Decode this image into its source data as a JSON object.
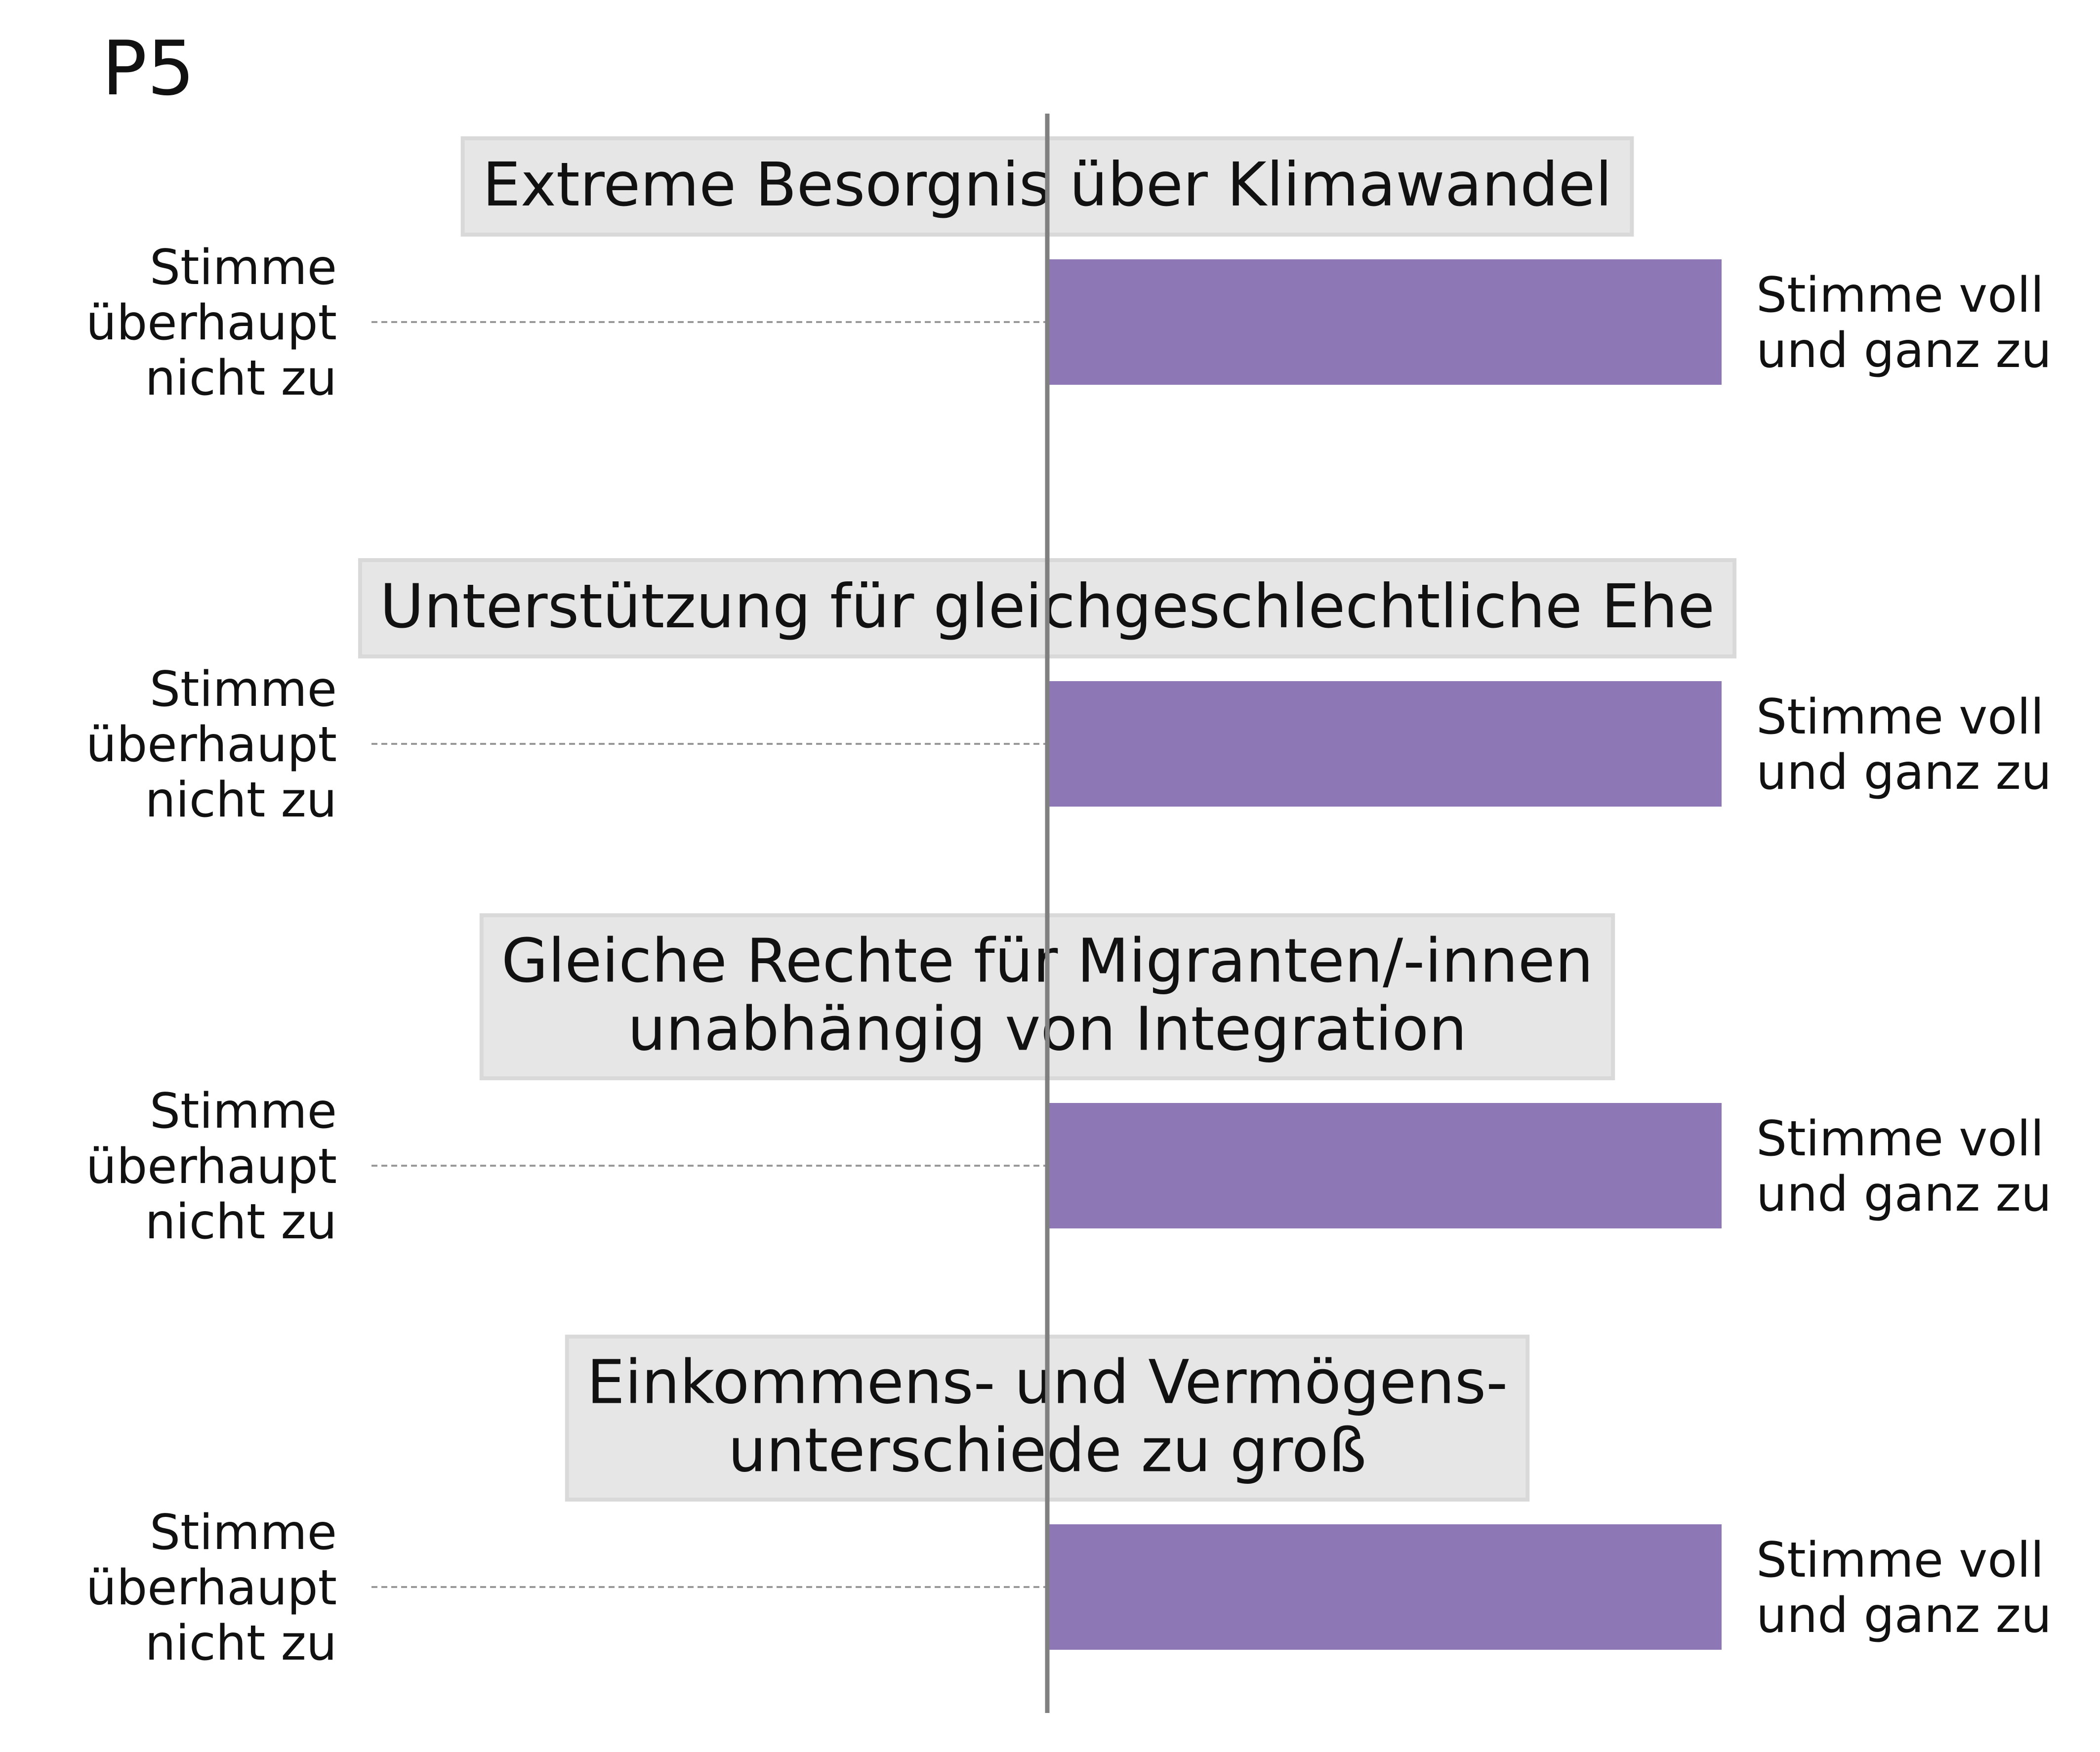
{
  "panel_label": "P5",
  "chart_data": {
    "type": "bar",
    "orientation": "horizontal",
    "categories": [
      "Extreme Besorgnis über Klimawandel",
      "Unterstützung für gleichgeschlechtliche Ehe",
      "Gleiche Rechte für Migranten/-innen unabhängig von Integration",
      "Einkommens- und Vermögens-unterschiede zu groß"
    ],
    "items": [
      {
        "title_lines": [
          "Extreme Besorgnis über Klimawandel"
        ],
        "value": 1.0,
        "left_anchor_lines": [
          "Stimme",
          "überhaupt",
          "nicht zu"
        ],
        "right_anchor_lines": [
          "Stimme voll",
          "und ganz zu"
        ]
      },
      {
        "title_lines": [
          "Unterstützung für gleichgeschlechtliche Ehe"
        ],
        "value": 1.0,
        "left_anchor_lines": [
          "Stimme",
          "überhaupt",
          "nicht zu"
        ],
        "right_anchor_lines": [
          "Stimme voll",
          "und ganz zu"
        ]
      },
      {
        "title_lines": [
          "Gleiche Rechte für Migranten/-innen",
          "unabhängig von Integration"
        ],
        "value": 1.0,
        "left_anchor_lines": [
          "Stimme",
          "überhaupt",
          "nicht zu"
        ],
        "right_anchor_lines": [
          "Stimme voll",
          "und ganz zu"
        ]
      },
      {
        "title_lines": [
          "Einkommens- und Vermögens-",
          "unterschiede zu groß"
        ],
        "value": 1.0,
        "left_anchor_lines": [
          "Stimme",
          "überhaupt",
          "nicht zu"
        ],
        "right_anchor_lines": [
          "Stimme voll",
          "und ganz zu"
        ]
      }
    ],
    "xlim": [
      -1,
      1
    ],
    "center_line": true,
    "grid": false,
    "colors": {
      "bar": "#8e77b5",
      "center_line": "#808080",
      "title_box_fill": "#e6e6e6",
      "title_box_stroke": "#d9d9d9",
      "dashed_line": "#999999"
    }
  }
}
